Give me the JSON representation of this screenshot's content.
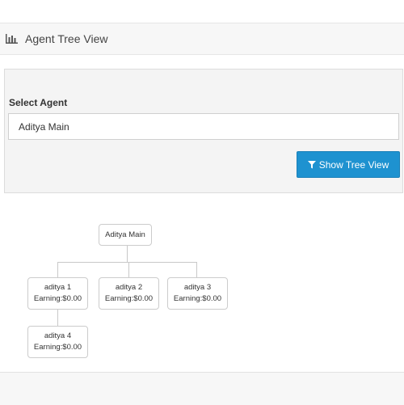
{
  "header": {
    "title": "Agent Tree View",
    "icon": "bar-chart-icon"
  },
  "filter": {
    "label": "Select Agent",
    "selected_agent": "Aditya Main",
    "button_label": "Show Tree View",
    "button_icon": "filter-icon",
    "button_color": "#1e92d0"
  },
  "tree": {
    "root": {
      "name": "Aditya Main"
    },
    "nodes": [
      {
        "name": "aditya 1",
        "earning": "Earning:$0.00"
      },
      {
        "name": "aditya 2",
        "earning": "Earning:$0.00"
      },
      {
        "name": "aditya 3",
        "earning": "Earning:$0.00"
      },
      {
        "name": "aditya 4",
        "earning": "Earning:$0.00"
      }
    ]
  }
}
